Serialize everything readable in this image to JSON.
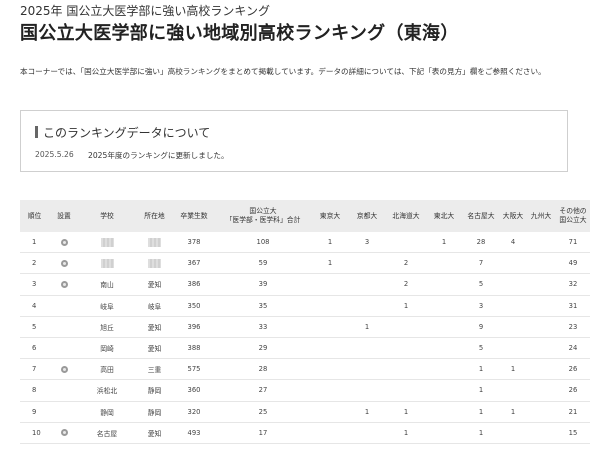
{
  "page": {
    "kicker": "2025年 国公立大医学部に強い高校ランキング",
    "title": "国公立大医学部に強い地域別高校ランキング（東海）",
    "intro": "本コーナーでは、「国公立大医学部に強い」高校ランキングをまとめて掲載しています。データの詳細については、下記「表の見方」欄をご参照ください。"
  },
  "notice": {
    "heading": "このランキングデータについて",
    "date": "2025.5.26",
    "text": "2025年度のランキングに更新しました。"
  },
  "table": {
    "headers": {
      "rank": "順位",
      "setup": "設置",
      "school": "学校",
      "location": "所在地",
      "grads": "卒業生数",
      "total_line1": "国公立大",
      "total_line2": "「医学部・医学科」合計",
      "tokyo": "東京大",
      "kyoto": "京都大",
      "hokkaido": "北海道大",
      "tohoku": "東北大",
      "nagoya": "名古屋大",
      "osaka": "大阪大",
      "kyushu": "九州大",
      "other_line1": "その他の",
      "other_line2": "国公立大"
    },
    "rows": [
      {
        "rank": "1",
        "setup_icon": true,
        "school": "",
        "school_blurred": true,
        "location": "",
        "location_blurred": true,
        "grads": "378",
        "total": "108",
        "tokyo": "1",
        "kyoto": "3",
        "hokkaido": "",
        "tohoku": "1",
        "nagoya": "28",
        "osaka": "4",
        "kyushu": "",
        "other": "71"
      },
      {
        "rank": "2",
        "setup_icon": true,
        "school": "",
        "school_blurred": true,
        "location": "",
        "location_blurred": true,
        "grads": "367",
        "total": "59",
        "tokyo": "1",
        "kyoto": "",
        "hokkaido": "2",
        "tohoku": "",
        "nagoya": "7",
        "osaka": "",
        "kyushu": "",
        "other": "49"
      },
      {
        "rank": "3",
        "setup_icon": true,
        "school": "南山",
        "school_blurred": false,
        "location": "愛知",
        "location_blurred": false,
        "grads": "386",
        "total": "39",
        "tokyo": "",
        "kyoto": "",
        "hokkaido": "2",
        "tohoku": "",
        "nagoya": "5",
        "osaka": "",
        "kyushu": "",
        "other": "32"
      },
      {
        "rank": "4",
        "setup_icon": false,
        "school": "岐阜",
        "school_blurred": false,
        "location": "岐阜",
        "location_blurred": false,
        "grads": "350",
        "total": "35",
        "tokyo": "",
        "kyoto": "",
        "hokkaido": "1",
        "tohoku": "",
        "nagoya": "3",
        "osaka": "",
        "kyushu": "",
        "other": "31"
      },
      {
        "rank": "5",
        "setup_icon": false,
        "school": "旭丘",
        "school_blurred": false,
        "location": "愛知",
        "location_blurred": false,
        "grads": "396",
        "total": "33",
        "tokyo": "",
        "kyoto": "1",
        "hokkaido": "",
        "tohoku": "",
        "nagoya": "9",
        "osaka": "",
        "kyushu": "",
        "other": "23"
      },
      {
        "rank": "6",
        "setup_icon": false,
        "school": "岡崎",
        "school_blurred": false,
        "location": "愛知",
        "location_blurred": false,
        "grads": "388",
        "total": "29",
        "tokyo": "",
        "kyoto": "",
        "hokkaido": "",
        "tohoku": "",
        "nagoya": "5",
        "osaka": "",
        "kyushu": "",
        "other": "24"
      },
      {
        "rank": "7",
        "setup_icon": true,
        "school": "高田",
        "school_blurred": false,
        "location": "三重",
        "location_blurred": false,
        "grads": "575",
        "total": "28",
        "tokyo": "",
        "kyoto": "",
        "hokkaido": "",
        "tohoku": "",
        "nagoya": "1",
        "osaka": "1",
        "kyushu": "",
        "other": "26"
      },
      {
        "rank": "8",
        "setup_icon": false,
        "school": "浜松北",
        "school_blurred": false,
        "location": "静岡",
        "location_blurred": false,
        "grads": "360",
        "total": "27",
        "tokyo": "",
        "kyoto": "",
        "hokkaido": "",
        "tohoku": "",
        "nagoya": "1",
        "osaka": "",
        "kyushu": "",
        "other": "26"
      },
      {
        "rank": "9",
        "setup_icon": false,
        "school": "静岡",
        "school_blurred": false,
        "location": "静岡",
        "location_blurred": false,
        "grads": "320",
        "total": "25",
        "tokyo": "",
        "kyoto": "1",
        "hokkaido": "1",
        "tohoku": "",
        "nagoya": "1",
        "osaka": "1",
        "kyushu": "",
        "other": "21"
      },
      {
        "rank": "10",
        "setup_icon": true,
        "school": "名古屋",
        "school_blurred": false,
        "location": "愛知",
        "location_blurred": false,
        "grads": "493",
        "total": "17",
        "tokyo": "",
        "kyoto": "",
        "hokkaido": "1",
        "tohoku": "",
        "nagoya": "1",
        "osaka": "",
        "kyushu": "",
        "other": "15"
      }
    ]
  },
  "icons": {
    "setup_icon": "private-school-icon",
    "blur": "redacted-text"
  }
}
